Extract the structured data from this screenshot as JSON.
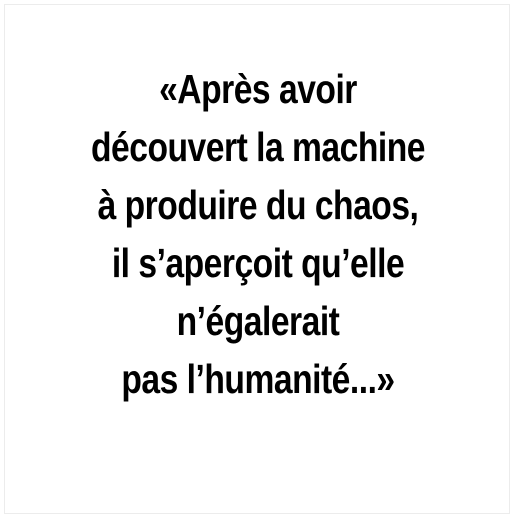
{
  "quote": {
    "lines": [
      "«Après avoir",
      "découvert la machine",
      "à produire du chaos,",
      "il s’aperçoit qu’elle",
      "n’égalerait",
      "pas l’humanité...»"
    ]
  }
}
